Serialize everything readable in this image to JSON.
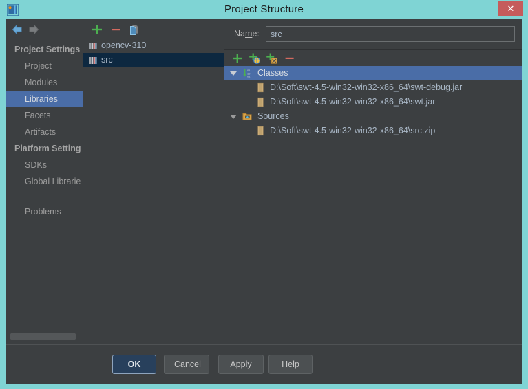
{
  "window": {
    "title": "Project Structure",
    "logo_icon": "intellij-idea-logo-icon",
    "close_label": "✕",
    "titlebar_color": "#7fd4d4",
    "close_color": "#c55c5c"
  },
  "sidebar": {
    "back_icon": "back-arrow-icon",
    "forward_icon": "forward-arrow-icon",
    "groups": [
      {
        "header": "Project Settings",
        "items": [
          {
            "label": "Project",
            "selected": false
          },
          {
            "label": "Modules",
            "selected": false
          },
          {
            "label": "Libraries",
            "selected": true
          },
          {
            "label": "Facets",
            "selected": false
          },
          {
            "label": "Artifacts",
            "selected": false
          }
        ]
      },
      {
        "header": "Platform Setting",
        "items": [
          {
            "label": "SDKs",
            "selected": false
          },
          {
            "label": "Global Librarie",
            "selected": false
          }
        ]
      }
    ],
    "problems_label": "Problems",
    "selection_color": "#4a6da7"
  },
  "middle_panel": {
    "toolbar": [
      {
        "name": "add-library-button",
        "icon": "plus-icon",
        "label": "+"
      },
      {
        "name": "remove-library-button",
        "icon": "minus-icon",
        "label": "−"
      },
      {
        "name": "copy-library-button",
        "icon": "copy-pages-icon",
        "label": ""
      }
    ],
    "libraries": [
      {
        "label": "opencv-310",
        "icon": "library-books-icon",
        "selected": false
      },
      {
        "label": "src",
        "icon": "library-books-icon",
        "selected": true
      }
    ],
    "selection_color": "#0d2840"
  },
  "right_panel": {
    "name_label_pre": "Na",
    "name_label_mnemonic": "m",
    "name_label_post": "e:",
    "name_value": "src",
    "name_placeholder": "",
    "toolbar": [
      {
        "name": "attach-files-button",
        "icon": "plus-icon"
      },
      {
        "name": "attach-url-button",
        "icon": "plus-globe-icon"
      },
      {
        "name": "attach-jar-directories-button",
        "icon": "plus-archive-icon"
      },
      {
        "name": "remove-root-button",
        "icon": "minus-icon"
      }
    ],
    "tree": [
      {
        "label": "Classes",
        "icon": "classes-binary-icon",
        "expanded": true,
        "selected": true,
        "children": [
          {
            "label": "D:\\Soft\\swt-4.5-win32-win32-x86_64\\swt-debug.jar",
            "icon": "jar-archive-icon"
          },
          {
            "label": "D:\\Soft\\swt-4.5-win32-win32-x86_64\\swt.jar",
            "icon": "jar-archive-icon"
          }
        ]
      },
      {
        "label": "Sources",
        "icon": "sources-folder-icon",
        "expanded": true,
        "selected": false,
        "children": [
          {
            "label": "D:\\Soft\\swt-4.5-win32-win32-x86_64\\src.zip",
            "icon": "jar-archive-icon"
          }
        ]
      }
    ],
    "selection_color": "#4a6da7"
  },
  "buttons": {
    "ok": "OK",
    "cancel": "Cancel",
    "apply_pre": "",
    "apply_mnemonic": "A",
    "apply_post": "pply",
    "help": "Help"
  }
}
